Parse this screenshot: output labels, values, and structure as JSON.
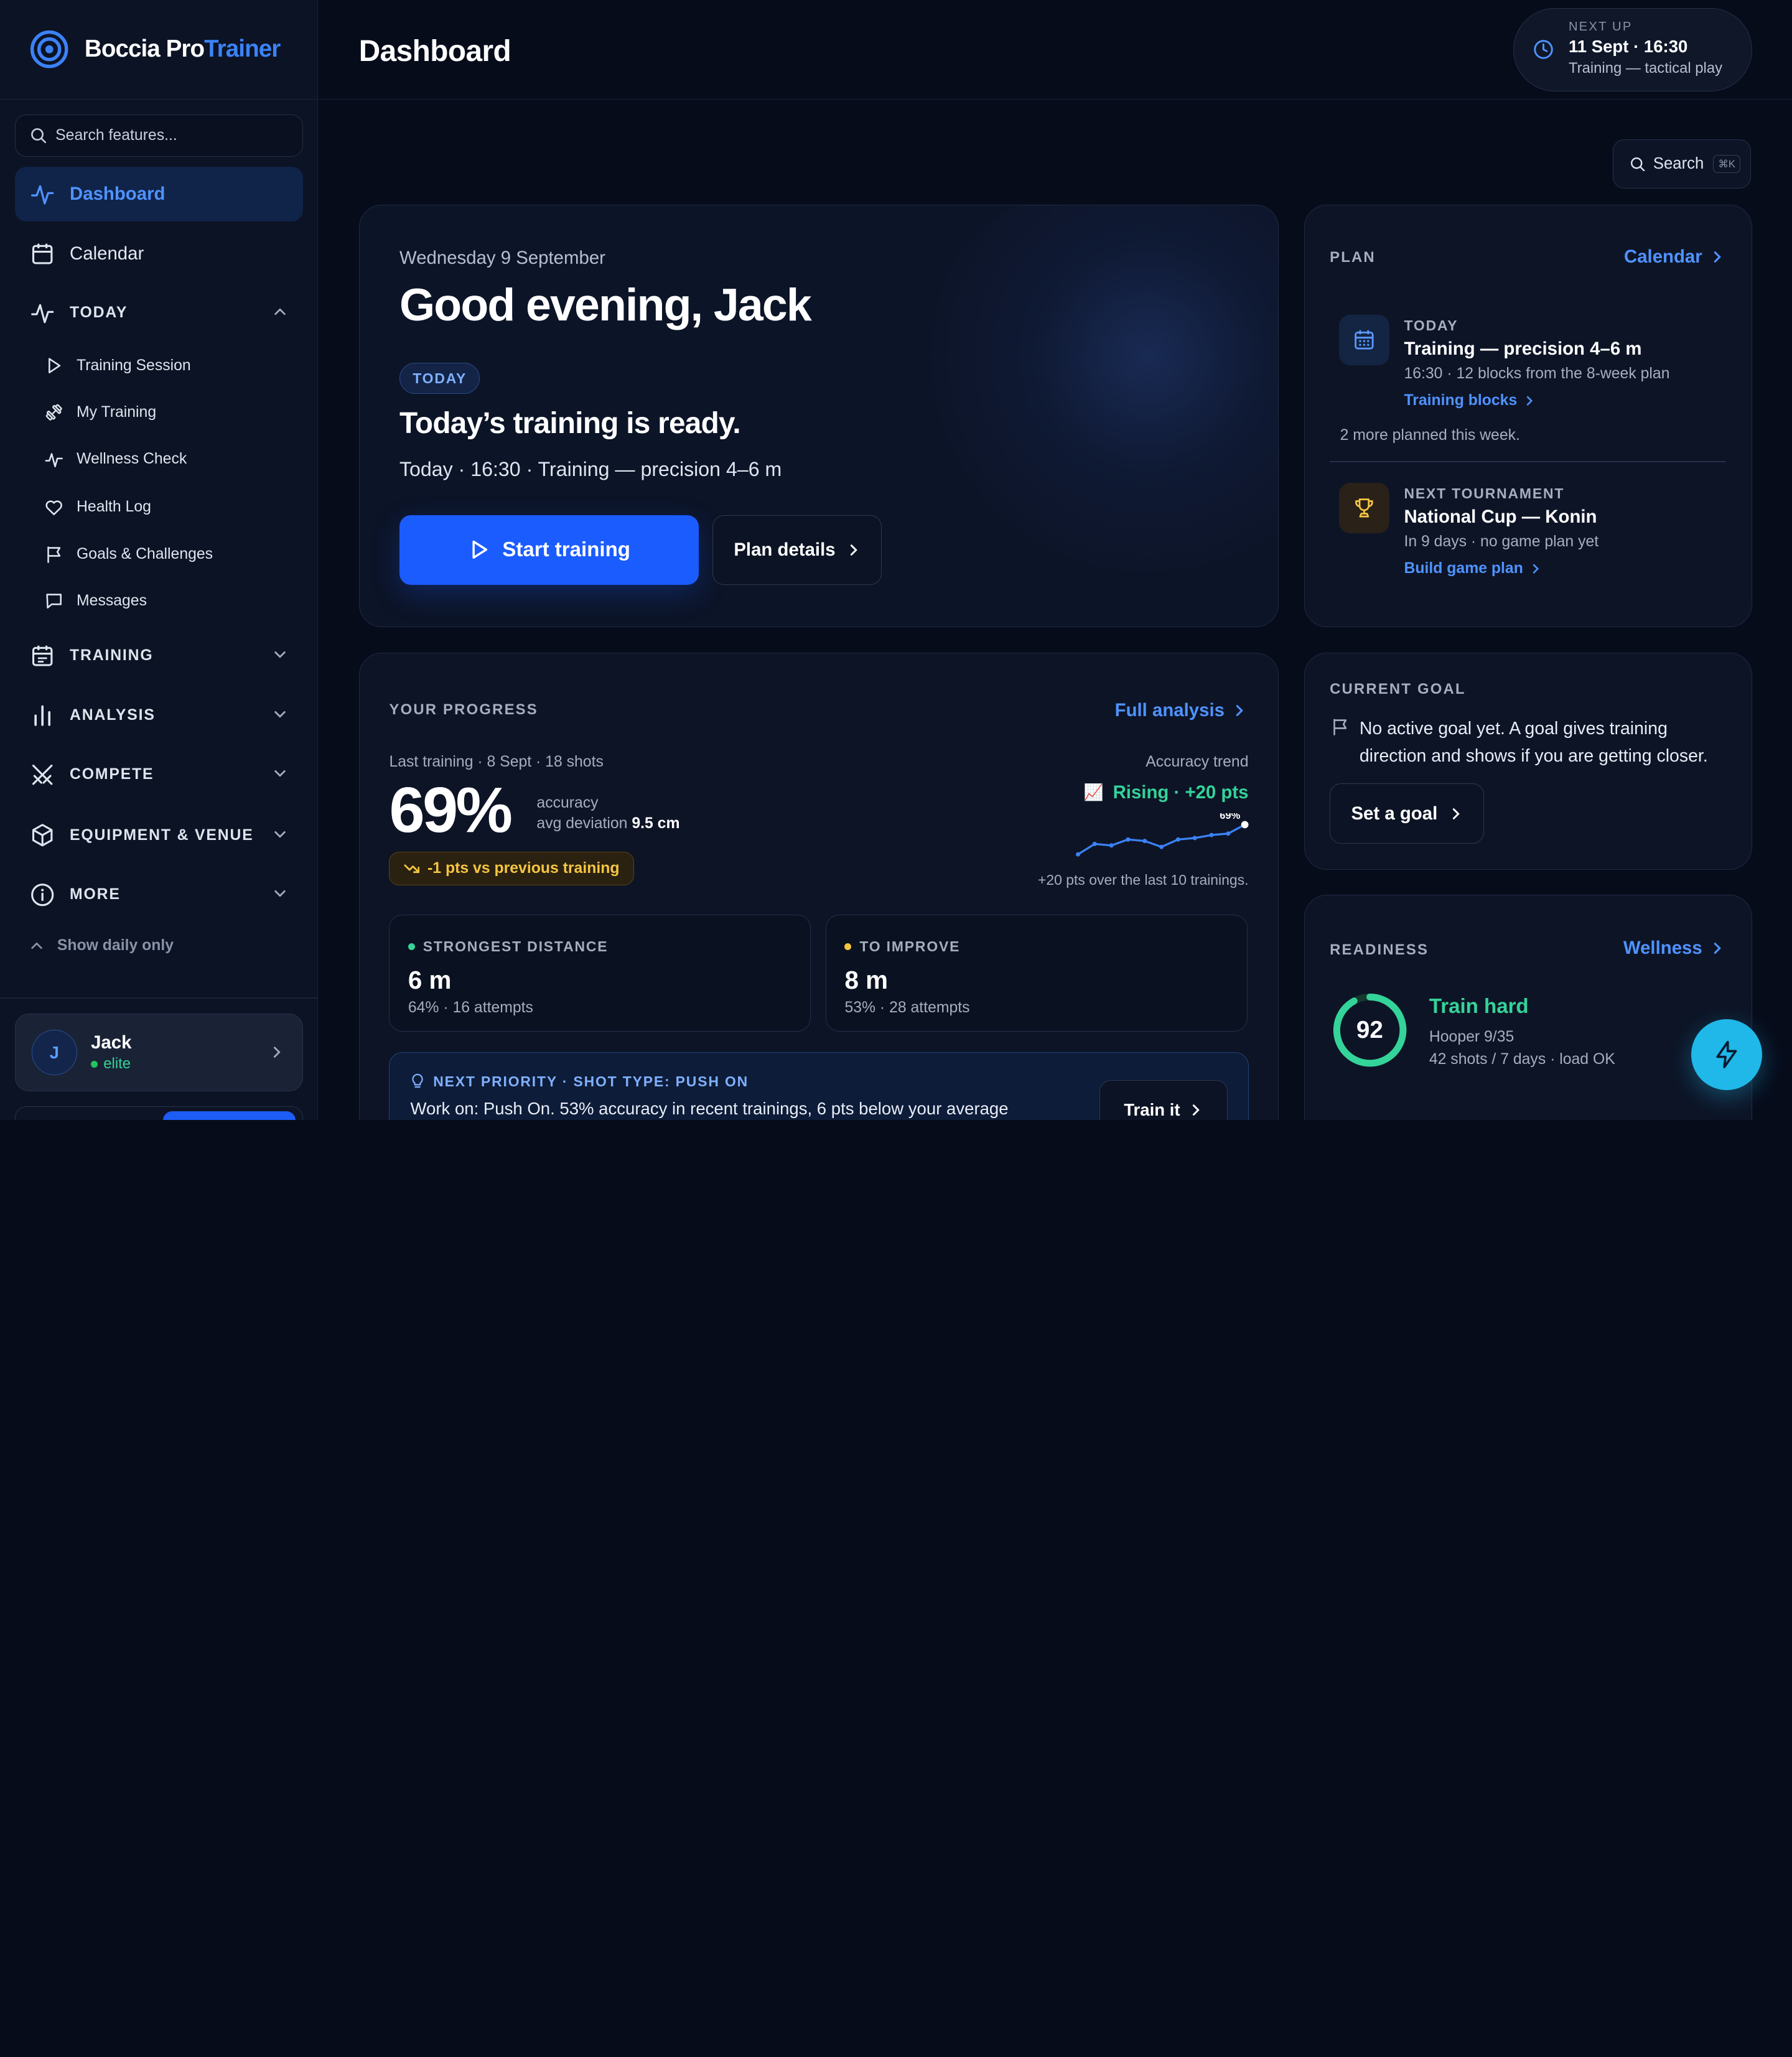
{
  "brand": {
    "name_main": "Boccia Pro",
    "name_accent": "Trainer"
  },
  "sidebar": {
    "search_placeholder": "Search features...",
    "dashboard": "Dashboard",
    "calendar": "Calendar",
    "today_section": "TODAY",
    "today_items": [
      "Training Session",
      "My Training",
      "Wellness Check",
      "Health Log",
      "Goals & Challenges",
      "Messages"
    ],
    "sections": [
      "TRAINING",
      "ANALYSIS",
      "COMPETE",
      "EQUIPMENT & VENUE",
      "MORE"
    ],
    "show_daily": "Show daily only",
    "user": {
      "initial": "J",
      "name": "Jack",
      "level": "elite"
    }
  },
  "header": {
    "title": "Dashboard",
    "next_up": {
      "label": "NEXT UP",
      "when": "11 Sept · 16:30",
      "what": "Training — tactical play"
    },
    "search_label": "Search",
    "search_kbd": "⌘K"
  },
  "hero": {
    "date": "Wednesday 9 September",
    "greeting": "Good evening, Jack",
    "badge": "TODAY",
    "headline": "Today’s training is ready.",
    "detail": "Today · 16:30 · Training — precision 4–6 m",
    "primary_button": "Start training",
    "secondary_button": "Plan details"
  },
  "plan": {
    "label": "PLAN",
    "link": "Calendar",
    "today": {
      "label": "TODAY",
      "title": "Training — precision 4–6 m",
      "sub": "16:30 · 12 blocks from the 8-week plan",
      "link": "Training blocks"
    },
    "more": "2 more planned this week.",
    "tournament": {
      "label": "NEXT TOURNAMENT",
      "title": "National Cup — Konin",
      "sub": "In 9 days · no game plan yet",
      "link": "Build game plan"
    }
  },
  "progress": {
    "label": "YOUR PROGRESS",
    "link": "Full analysis",
    "last_training": "Last training · 8 Sept · 18 shots",
    "accuracy": "69%",
    "accuracy_label": "accuracy",
    "deviation_label": "avg deviation",
    "deviation_value": "9.5 cm",
    "delta": "-1 pts vs previous training",
    "trend_label": "Accuracy trend",
    "trend_emoji": "📈",
    "trend_value": "Rising · +20 pts",
    "trend_end_label": "69%",
    "trend_points": [
      49,
      56,
      55,
      59,
      58,
      54,
      59,
      60,
      62,
      63,
      69
    ],
    "trend_foot": "+20 pts over the last 10 trainings.",
    "strongest": {
      "label": "STRONGEST DISTANCE",
      "value": "6 m",
      "sub": "64% · 16 attempts",
      "color": "#34d399"
    },
    "improve": {
      "label": "TO IMPROVE",
      "value": "8 m",
      "sub": "53% · 28 attempts",
      "color": "#f5c542"
    },
    "priority": {
      "label": "NEXT PRIORITY · SHOT TYPE: PUSH ON",
      "text": "Work on: Push On. 53% accuracy in recent trainings, 6 pts below your average",
      "button": "Train it"
    }
  },
  "goal": {
    "label": "CURRENT GOAL",
    "text": "No active goal yet. A goal gives training direction and shows if you are getting closer.",
    "button": "Set a goal"
  },
  "readiness": {
    "label": "READINESS",
    "link": "Wellness",
    "score": "92",
    "score_fraction": 0.92,
    "status": "Train hard",
    "hooper": "Hooper 9/35",
    "load": "42 shots / 7 days · load OK"
  },
  "colors": {
    "accent": "#1b5cff",
    "positive": "#34d399",
    "warning": "#f5c542",
    "fab": "#1fb8e8"
  }
}
